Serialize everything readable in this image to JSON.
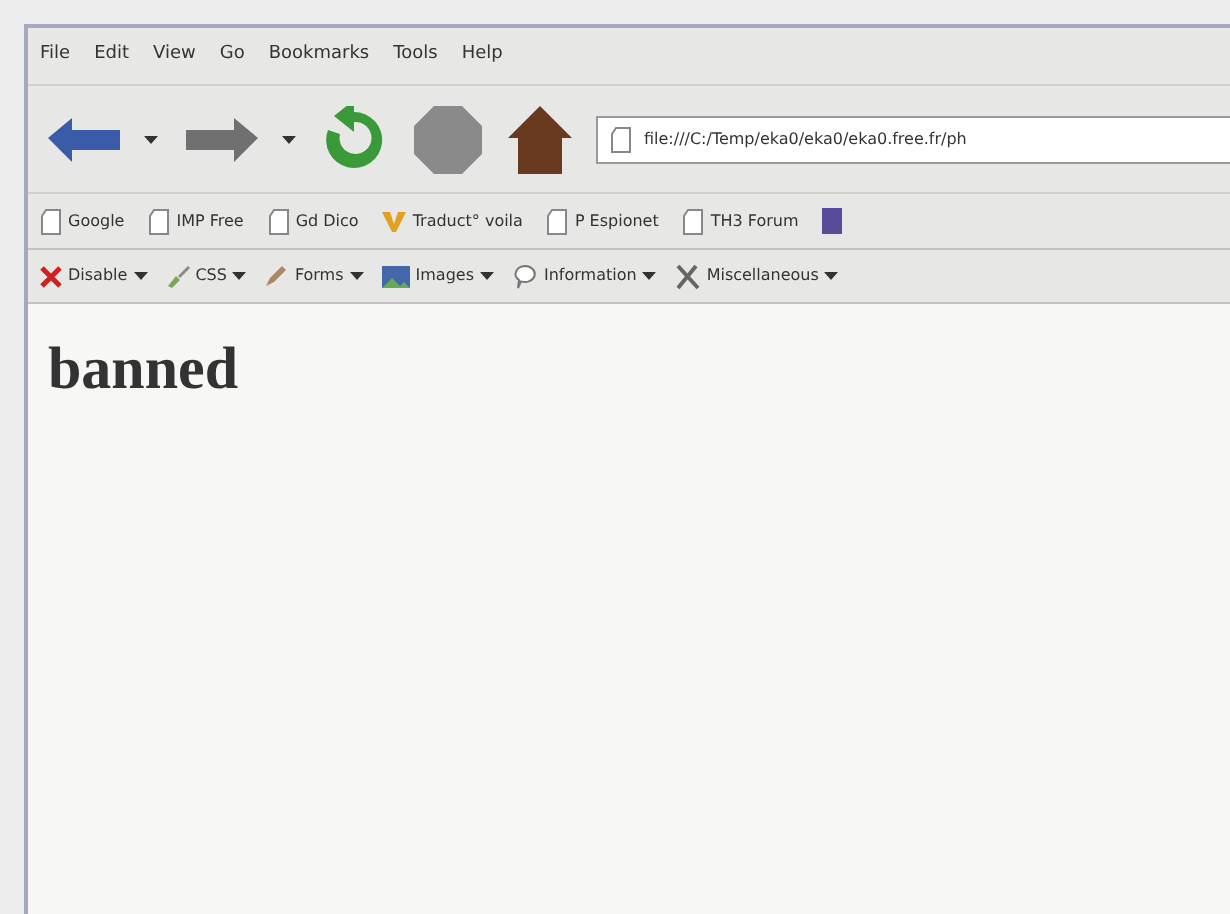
{
  "menu_bar": [
    "File",
    "Edit",
    "View",
    "Go",
    "Bookmarks",
    "Tools",
    "Help"
  ],
  "address_bar": {
    "value": "file:///C:/Temp/eka0/eka0/eka0.free.fr/ph"
  },
  "bookmarks": [
    {
      "label": "Google",
      "kind": "page"
    },
    {
      "label": "IMP Free",
      "kind": "page"
    },
    {
      "label": "Gd Dico",
      "kind": "page"
    },
    {
      "label": "Traduct° voila",
      "kind": "voila"
    },
    {
      "label": "P Espionet",
      "kind": "page"
    },
    {
      "label": "TH3 Forum",
      "kind": "page"
    }
  ],
  "developer_toolbar": [
    {
      "label": "Disable",
      "kind": "disable"
    },
    {
      "label": "CSS",
      "kind": "css"
    },
    {
      "label": "Forms",
      "kind": "forms"
    },
    {
      "label": "Images",
      "kind": "images"
    },
    {
      "label": "Information",
      "kind": "information"
    },
    {
      "label": "Miscellaneous",
      "kind": "misc"
    }
  ],
  "content": {
    "heading": "banned"
  }
}
